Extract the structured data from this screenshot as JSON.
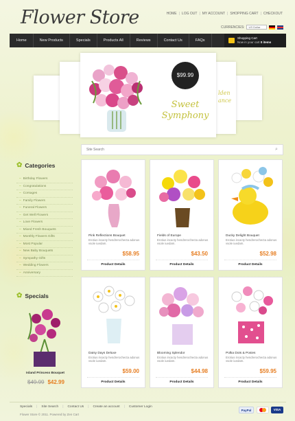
{
  "header": {
    "logo": "Flower Store",
    "top_links": [
      "HOME",
      "LOG OUT",
      "MY ACCOUNT",
      "SHOPPING CART",
      "CHECKOUT"
    ],
    "currency_label": "CURRENCIES:",
    "currency_value": "US Dollar"
  },
  "nav": {
    "items": [
      "Home",
      "New Products",
      "Specials",
      "Products All",
      "Reviews",
      "Contact Us",
      "FAQs"
    ],
    "cart_title": "Shopping Cart",
    "cart_prefix": "Now in your cart",
    "cart_count": "0 items"
  },
  "slider": {
    "price": "$99.99",
    "title_line1": "Sweet",
    "title_line2": "Symphony",
    "side_text": "lden\nance"
  },
  "search": {
    "placeholder": "Site Search"
  },
  "sidebar": {
    "categories_title": "Categories",
    "categories": [
      "Birthday Flowers",
      "Congratulations",
      "Corsages",
      "Family Flowers",
      "Funeral Flowers",
      "Get Well Flowers",
      "Love Flowers",
      "Mixed Fresh Bouquets",
      "Monthly Flowers Gifts",
      "Most Popular",
      "New Baby Bouquets",
      "Sympathy Gifts",
      "Wedding Flowers",
      "Anniversary"
    ],
    "specials_title": "Specials",
    "special": {
      "name": "Island Princess Bouquet",
      "old_price": "$49.99",
      "new_price": "$42.99"
    }
  },
  "products": [
    {
      "name": "Pink Reflections Bouquet",
      "desc": "Erotius incacty hendrerochecta adonus vsole iuedam.",
      "price": "$58.95",
      "detail": "Product Details"
    },
    {
      "name": "Fields of Europe",
      "desc": "Erotius incacty hendrerochecta adonus vsole iuedam.",
      "price": "$43.50",
      "detail": "Product Details"
    },
    {
      "name": "Ducky Delight Bouquet",
      "desc": "Erotius incacty hendrerochecta adonus vsole iuedam.",
      "price": "$52.98",
      "detail": "Product Details"
    },
    {
      "name": "Daisy Days Deluxe",
      "desc": "Erotius incacty hendrerochecta adonus vsole iuedam.",
      "price": "$59.00",
      "detail": "Product Details"
    },
    {
      "name": "Blooming Splendor",
      "desc": "Erotius incacty hendrerochecta adonus vsole iuedam.",
      "price": "$44.98",
      "detail": "Product Details"
    },
    {
      "name": "Polka Dots & Posies",
      "desc": "Erotius incacty hendrerochecta adonus vsole iuedam.",
      "price": "$59.95",
      "detail": "Product Details"
    }
  ],
  "footer": {
    "links": [
      "Specials",
      "Site Search",
      "Contact Us",
      "Create an account",
      "Customer Login"
    ],
    "copyright": "Flower Store © 2011. Powered by Zen Cart",
    "pay_paypal": "PayPal",
    "pay_visa": "VISA"
  },
  "colors": {
    "accent": "#e67e22",
    "nav_bg": "#2b2b2b",
    "leaf_green": "#9bbf2a"
  }
}
